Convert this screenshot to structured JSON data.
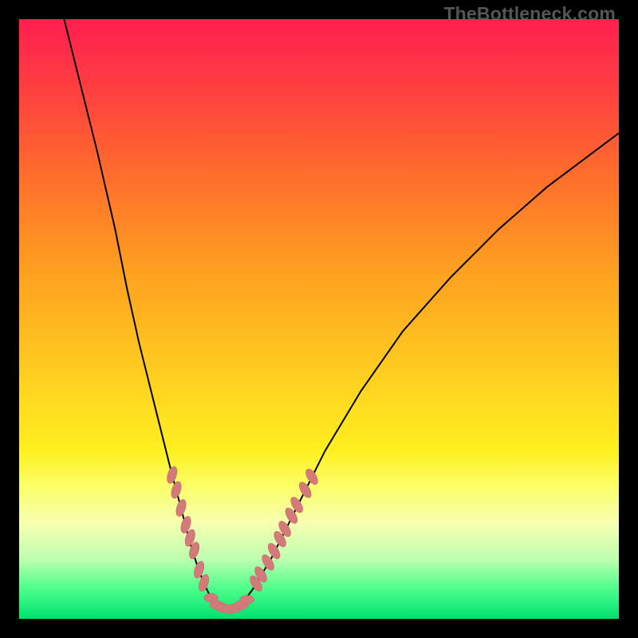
{
  "watermark": "TheBottleneck.com",
  "colors": {
    "frame": "#000000",
    "bead": "#d47a7a",
    "curve": "#000000",
    "gradient_top": "#ff1f4f",
    "gradient_bottom": "#00e070"
  },
  "chart_data": {
    "type": "line",
    "title": "",
    "xlabel": "",
    "ylabel": "",
    "xlim": [
      0,
      100
    ],
    "ylim": [
      0,
      100
    ],
    "grid": false,
    "legend": false,
    "series": [
      {
        "name": "left-branch",
        "x": [
          7,
          10,
          13,
          16,
          18,
          20,
          22,
          24,
          25.5,
          27,
          28,
          29,
          30,
          31,
          32,
          33
        ],
        "y": [
          102,
          90,
          78,
          65,
          55,
          46,
          38,
          30,
          24,
          18.5,
          14.5,
          11,
          8,
          5.5,
          3.5,
          2.3
        ]
      },
      {
        "name": "valley",
        "x": [
          33,
          34,
          35,
          36,
          37
        ],
        "y": [
          2.3,
          1.8,
          1.6,
          1.8,
          2.3
        ]
      },
      {
        "name": "right-branch",
        "x": [
          37,
          39,
          42,
          46,
          51,
          57,
          64,
          72,
          80,
          88,
          96,
          100
        ],
        "y": [
          2.3,
          5,
          10,
          18,
          28,
          38,
          48,
          57,
          65,
          72,
          78,
          81
        ]
      }
    ],
    "beads_left": [
      {
        "x": 25.5,
        "y": 24.0
      },
      {
        "x": 26.2,
        "y": 21.5
      },
      {
        "x": 27.0,
        "y": 18.5
      },
      {
        "x": 27.8,
        "y": 15.7
      },
      {
        "x": 28.5,
        "y": 13.5
      },
      {
        "x": 29.2,
        "y": 11.4
      },
      {
        "x": 30.0,
        "y": 8.2
      },
      {
        "x": 30.8,
        "y": 6.0
      }
    ],
    "beads_bottom": [
      {
        "x": 32.0,
        "y": 3.5
      },
      {
        "x": 33.0,
        "y": 2.3
      },
      {
        "x": 34.0,
        "y": 1.8
      },
      {
        "x": 35.0,
        "y": 1.6
      },
      {
        "x": 36.0,
        "y": 1.8
      },
      {
        "x": 37.0,
        "y": 2.3
      },
      {
        "x": 38.0,
        "y": 3.2
      }
    ],
    "beads_right": [
      {
        "x": 39.5,
        "y": 5.9
      },
      {
        "x": 40.3,
        "y": 7.4
      },
      {
        "x": 41.5,
        "y": 9.4
      },
      {
        "x": 42.5,
        "y": 11.3
      },
      {
        "x": 43.5,
        "y": 13.3
      },
      {
        "x": 44.3,
        "y": 15.0
      },
      {
        "x": 45.4,
        "y": 17.2
      },
      {
        "x": 46.3,
        "y": 19.0
      },
      {
        "x": 47.7,
        "y": 21.5
      },
      {
        "x": 48.8,
        "y": 23.7
      }
    ]
  }
}
